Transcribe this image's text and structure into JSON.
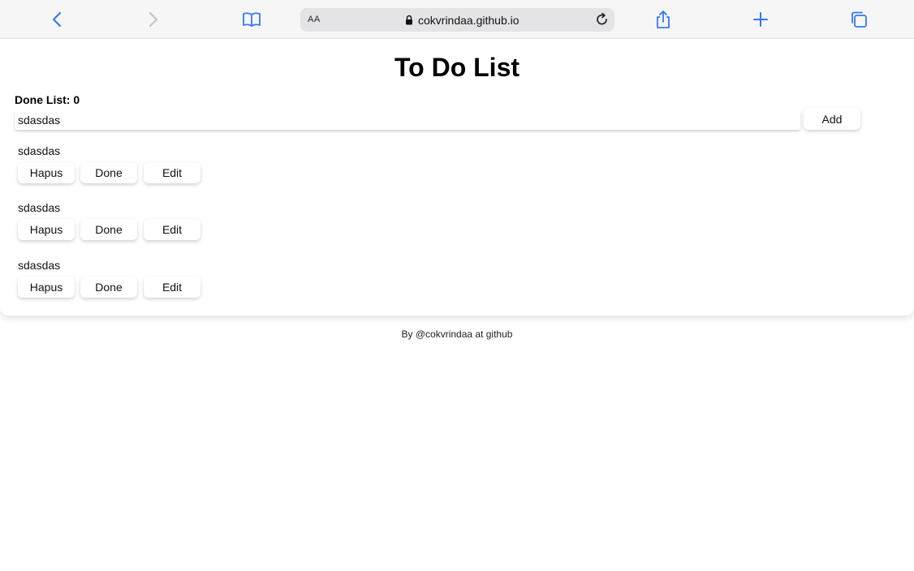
{
  "browser": {
    "aa_label": "AA",
    "url": "cokvrindaa.github.io",
    "accent_color": "#3478f6",
    "icons": [
      "back-icon",
      "forward-icon",
      "bookmarks-icon",
      "lock-icon",
      "reload-icon",
      "share-icon",
      "new-tab-icon",
      "tabs-icon"
    ]
  },
  "page": {
    "title": "To Do List",
    "done_label": "Done List: 0",
    "input_value": "sdasdas",
    "add_label": "Add",
    "items": [
      {
        "text": "sdasdas",
        "delete_label": "Hapus",
        "done_label": "Done",
        "edit_label": "Edit"
      },
      {
        "text": "sdasdas",
        "delete_label": "Hapus",
        "done_label": "Done",
        "edit_label": "Edit"
      },
      {
        "text": "sdasdas",
        "delete_label": "Hapus",
        "done_label": "Done",
        "edit_label": "Edit"
      }
    ],
    "footer": "By @cokvrindaa at github"
  }
}
